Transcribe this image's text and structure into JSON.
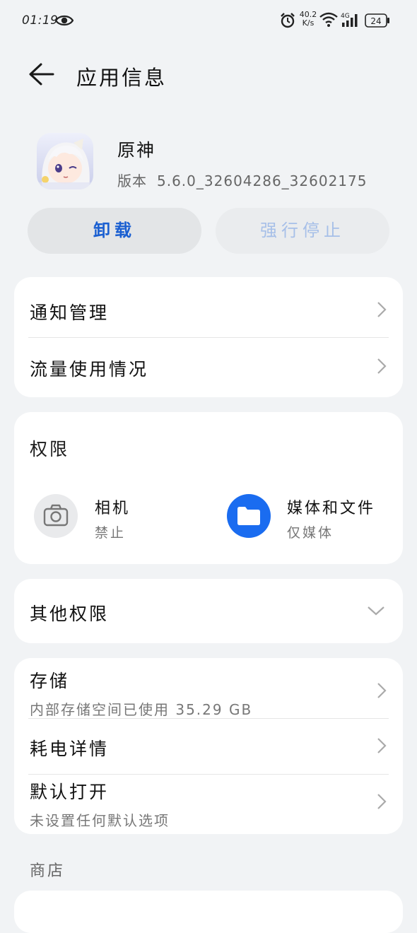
{
  "status_bar": {
    "time": "01:19",
    "net_speed_value": "40.2",
    "net_speed_unit": "K/s",
    "network_type": "4G",
    "battery": "24"
  },
  "header": {
    "title": "应用信息"
  },
  "app": {
    "name": "原神",
    "version_label": "版本",
    "version": "5.6.0_32604286_32602175"
  },
  "actions": {
    "uninstall": "卸载",
    "force_stop": "强行停止"
  },
  "general": {
    "items": [
      {
        "label": "通知管理"
      },
      {
        "label": "流量使用情况"
      }
    ]
  },
  "permissions": {
    "title": "权限",
    "items": [
      {
        "name": "相机",
        "status": "禁止",
        "icon": "camera-icon",
        "active": false,
        "color": "#e9eaec"
      },
      {
        "name": "媒体和文件",
        "status": "仅媒体",
        "icon": "folder-icon",
        "active": true,
        "color": "#1a6cf0"
      }
    ]
  },
  "other_permissions": {
    "label": "其他权限"
  },
  "details": {
    "items": [
      {
        "label": "存储",
        "sub": "内部存储空间已使用 35.29 GB"
      },
      {
        "label": "耗电详情",
        "sub": ""
      },
      {
        "label": "默认打开",
        "sub": "未设置任何默认选项"
      }
    ]
  },
  "store_section": {
    "label": "商店"
  },
  "theme": {
    "accent": "#1a5fd1",
    "disabled_accent": "#a6bfe8",
    "background": "#f1f3f5"
  }
}
